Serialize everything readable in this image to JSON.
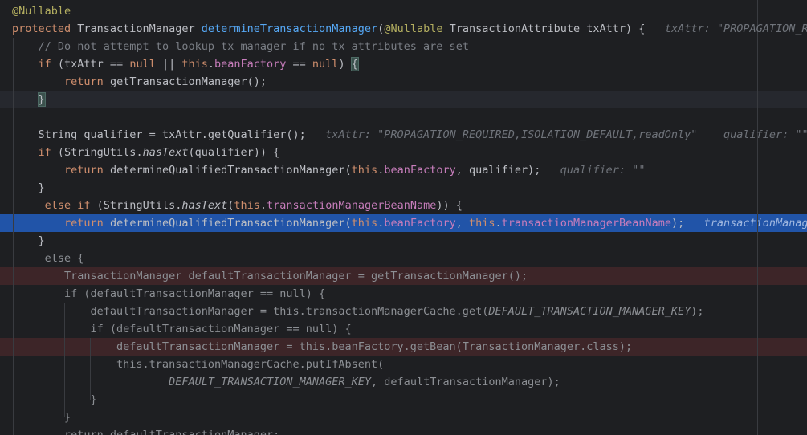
{
  "editor": {
    "language": "Java",
    "colors": {
      "background": "#1e1f22",
      "current_line": "#26282e",
      "execution_line": "#2154a8",
      "breakpoint_line": "#3d2528",
      "keyword": "#cf8e6d",
      "method_declaration": "#56a8f5",
      "field": "#c77dbb",
      "annotation": "#b3ae60",
      "comment": "#7a7e85",
      "inlay_hint": "#6f737a"
    },
    "lines": [
      [
        [
          "ann",
          "@Nullable"
        ]
      ],
      [
        [
          "kw",
          "protected "
        ],
        [
          "plain",
          "TransactionManager "
        ],
        [
          "fn",
          "determineTransactionManager"
        ],
        [
          "plain",
          "("
        ],
        [
          "ann",
          "@Nullable "
        ],
        [
          "plain",
          "TransactionAttribute txAttr) {   "
        ],
        [
          "hint",
          "txAttr: \"PROPAGATION_REQUIRED,ISOLATION_DEFAULT,readOnly\""
        ]
      ],
      [
        [
          "plain",
          "    "
        ],
        [
          "comment",
          "// Do not attempt to lookup tx manager if no tx attributes are set"
        ]
      ],
      [
        [
          "plain",
          "    "
        ],
        [
          "kw",
          "if "
        ],
        [
          "plain",
          "(txAttr == "
        ],
        [
          "kw",
          "null "
        ],
        [
          "plain",
          "|| "
        ],
        [
          "kw",
          "this"
        ],
        [
          "plain",
          "."
        ],
        [
          "field",
          "beanFactory"
        ],
        [
          "plain",
          " == "
        ],
        [
          "kw",
          "null"
        ],
        [
          "plain",
          ") "
        ],
        [
          "brace",
          "{"
        ]
      ],
      [
        [
          "plain",
          "        "
        ],
        [
          "kw",
          "return "
        ],
        [
          "plain",
          "getTransactionManager();"
        ]
      ],
      [
        [
          "plain",
          "    "
        ],
        [
          "brace",
          "}"
        ]
      ],
      [],
      [
        [
          "plain",
          "    String qualifier = txAttr.getQualifier();   "
        ],
        [
          "hint",
          "txAttr: \"PROPAGATION_REQUIRED,ISOLATION_DEFAULT,readOnly\""
        ],
        [
          "plain",
          "    "
        ],
        [
          "hint",
          "qualifier: \"\""
        ]
      ],
      [
        [
          "plain",
          "    "
        ],
        [
          "kw",
          "if "
        ],
        [
          "plain",
          "(StringUtils."
        ],
        [
          "static",
          "hasText"
        ],
        [
          "plain",
          "(qualifier)) {"
        ]
      ],
      [
        [
          "plain",
          "        "
        ],
        [
          "kw",
          "return "
        ],
        [
          "plain",
          "determineQualifiedTransactionManager("
        ],
        [
          "kw",
          "this"
        ],
        [
          "plain",
          "."
        ],
        [
          "field",
          "beanFactory"
        ],
        [
          "plain",
          ", qualifier);   "
        ],
        [
          "hint",
          "qualifier: \"\""
        ]
      ],
      [
        [
          "plain",
          "    }"
        ]
      ],
      [
        [
          "plain",
          "     "
        ],
        [
          "kw",
          "else if "
        ],
        [
          "plain",
          "(StringUtils."
        ],
        [
          "static",
          "hasText"
        ],
        [
          "plain",
          "("
        ],
        [
          "kw",
          "this"
        ],
        [
          "plain",
          "."
        ],
        [
          "field",
          "transactionManagerBeanName"
        ],
        [
          "plain",
          ")) {"
        ]
      ],
      [
        [
          "plain",
          "        "
        ],
        [
          "kw",
          "return "
        ],
        [
          "plain",
          "determineQualifiedTransactionManager("
        ],
        [
          "kw",
          "this"
        ],
        [
          "plain",
          "."
        ],
        [
          "field",
          "beanFactory"
        ],
        [
          "plain",
          ", "
        ],
        [
          "kw",
          "this"
        ],
        [
          "plain",
          "."
        ],
        [
          "field",
          "transactionManagerBeanName"
        ],
        [
          "plain",
          ");   "
        ],
        [
          "hintdbg",
          "transactionManagerBeanName: null"
        ]
      ],
      [
        [
          "plain",
          "    }"
        ]
      ],
      [
        [
          "dim",
          "     else {"
        ]
      ],
      [
        [
          "dim",
          "        TransactionManager defaultTransactionManager = getTransactionManager();"
        ]
      ],
      [
        [
          "dim",
          "        if (defaultTransactionManager == null) {"
        ]
      ],
      [
        [
          "dim",
          "            defaultTransactionManager = this.transactionManagerCache.get("
        ],
        [
          "dimstatic",
          "DEFAULT_TRANSACTION_MANAGER_KEY"
        ],
        [
          "dim",
          ");"
        ]
      ],
      [
        [
          "dim",
          "            if (defaultTransactionManager == null) {"
        ]
      ],
      [
        [
          "dim",
          "                defaultTransactionManager = this.beanFactory.getBean(TransactionManager.class);"
        ]
      ],
      [
        [
          "dim",
          "                this.transactionManagerCache.putIfAbsent("
        ]
      ],
      [
        [
          "dim",
          "                        "
        ],
        [
          "dimstatic",
          "DEFAULT_TRANSACTION_MANAGER_KEY"
        ],
        [
          "dim",
          ", defaultTransactionManager);"
        ]
      ],
      [
        [
          "dim",
          "            }"
        ]
      ],
      [
        [
          "dim",
          "        }"
        ]
      ],
      [
        [
          "dim",
          "        return defaultTransactionManager;"
        ]
      ]
    ]
  }
}
